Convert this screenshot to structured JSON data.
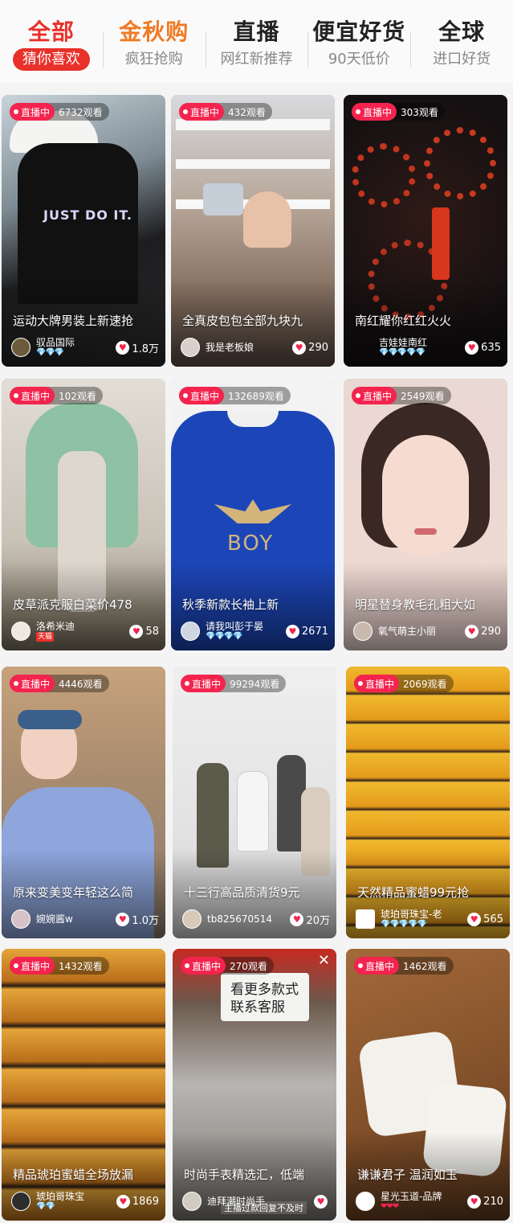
{
  "tabs": [
    {
      "title": "全部",
      "sub": "猜你喜欢"
    },
    {
      "title": "金秋购",
      "sub": "疯狂抢购"
    },
    {
      "title": "直播",
      "sub": "网红新推荐"
    },
    {
      "title": "便宜好货",
      "sub": "90天低价"
    },
    {
      "title": "全球",
      "sub": "进口好货"
    }
  ],
  "live_label": "直播中",
  "cards": [
    {
      "views": "6732观看",
      "title": "运动大牌男装上新速抢",
      "host": "驭品国际",
      "gems": "💎💎💎",
      "likes": "1.8万"
    },
    {
      "views": "432观看",
      "title": "全真皮包包全部九块九",
      "host": "我是老板娘",
      "gems": "",
      "likes": "290"
    },
    {
      "views": "303观看",
      "title": "南红耀你红红火火",
      "host": "吉娃娃南红",
      "gems": "💎💎💎💎💎",
      "likes": "635"
    },
    {
      "views": "102观看",
      "title": "皮草派克服白菜价478",
      "host": "洛希米迪",
      "tag": "天猫",
      "gems": "",
      "likes": "58"
    },
    {
      "views": "132689观看",
      "title": "秋季新款长袖上新",
      "host": "请我叫彭于晏",
      "gems": "💎💎💎💎",
      "likes": "2671"
    },
    {
      "views": "2549观看",
      "title": "明星替身教毛孔粗大如",
      "host": "氧气萌主小丽",
      "gems": "",
      "likes": "290"
    },
    {
      "views": "4446观看",
      "title": "原来变美变年轻这么简",
      "host": "婉婉酱w",
      "gems": "",
      "likes": "1.0万"
    },
    {
      "views": "99294观看",
      "title": "十三行高品质清货9元",
      "host": "tb825670514",
      "gems": "",
      "likes": "20万"
    },
    {
      "views": "2069观看",
      "title": "天然精品蜜蜡99元抢",
      "host": "琥珀哥珠宝-老",
      "gems": "💎💎💎💎💎",
      "likes": "565"
    },
    {
      "views": "1432观看",
      "title": "精品琥珀蜜蜡全场放漏",
      "host": "琥珀哥珠宝",
      "gems": "💎💎",
      "likes": "1869"
    },
    {
      "views": "270观看",
      "title": "时尚手表精选汇，低端",
      "host": "迪拜潮时尚手",
      "gems": "",
      "likes": "",
      "notice": "主播过款回复不及时"
    },
    {
      "views": "1462观看",
      "title": "谦谦君子 温润如玉",
      "host": "星光玉道-品牌",
      "gems": "❤❤❤",
      "likes": "210"
    }
  ],
  "icons": {
    "live": "live-dot-icon",
    "like": "heart-icon",
    "close": "close-icon"
  },
  "colors": {
    "accent": "#e8312a",
    "live": "#f3244e",
    "promo": "#f07a24"
  }
}
